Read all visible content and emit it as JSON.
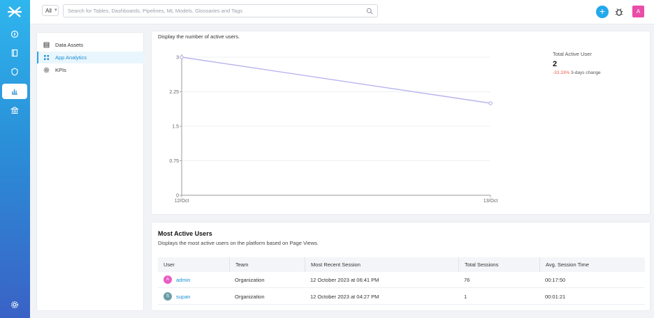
{
  "topbar": {
    "scope_label": "All",
    "search_placeholder": "Search for Tables, Dashboards, Pipelines, ML Models, Glossaries and Tags",
    "add_label": "+",
    "user_initial": "A"
  },
  "sidenav": {
    "items": [
      {
        "label": "Data Assets",
        "icon": "database-icon",
        "active": false
      },
      {
        "label": "App Analytics",
        "icon": "grid-icon",
        "active": true
      },
      {
        "label": "KPIs",
        "icon": "gear-icon",
        "active": false
      }
    ]
  },
  "chart_card": {
    "description": "Display the number of active users.",
    "summary": {
      "title": "Total Active User",
      "value": "2",
      "change_pct": "-33.33%",
      "change_text": "3-days change"
    }
  },
  "chart_data": {
    "type": "line",
    "x": [
      "12/Oct",
      "13/Oct"
    ],
    "series": [
      {
        "values": [
          3,
          2
        ],
        "color": "#b8b4ee"
      }
    ],
    "ylim": [
      0,
      3
    ],
    "yticks": [
      "0",
      "0.75",
      "1.5",
      "2.25",
      "3"
    ],
    "grid": true
  },
  "users_card": {
    "title": "Most Active Users",
    "subtitle": "Displays the most active users on the platform based on Page Views.",
    "columns": [
      "User",
      "Team",
      "Most Recent Session",
      "Total Sessions",
      "Avg. Session Time"
    ],
    "rows": [
      {
        "initial": "A",
        "avatar_color": "#e85bc4",
        "user": "admin",
        "team": "Organization",
        "recent": "12 October 2023 at 06:41 PM",
        "sessions": "76",
        "avg": "00:17:50"
      },
      {
        "initial": "S",
        "avatar_color": "#6a9ea8",
        "user": "supan",
        "team": "Organization",
        "recent": "12 October 2023 at 04:27 PM",
        "sessions": "1",
        "avg": "00:01:21"
      }
    ]
  },
  "colors": {
    "accent": "#24a8ec",
    "rail_top": "#2fb6ee",
    "rail_bottom": "#3a62c6",
    "negative": "#ef5b49",
    "link": "#1b8fd8"
  }
}
